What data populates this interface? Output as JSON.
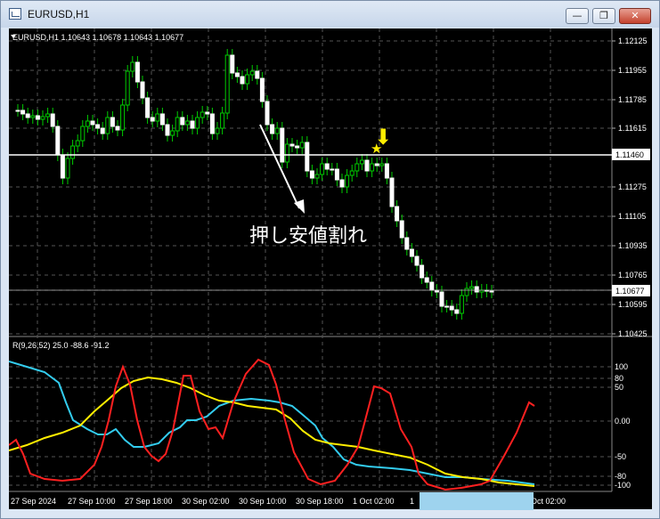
{
  "window": {
    "title": "EURUSD,H1",
    "minimize_glyph": "—",
    "restore_glyph": "❐",
    "close_glyph": "✕"
  },
  "main_chart": {
    "header": "EURUSD,H1  1.10643 1.10678 1.10643 1.10677",
    "price_axis": [
      "1.12125",
      "1.11955",
      "1.11785",
      "1.11615",
      "1.11460",
      "1.11275",
      "1.11105",
      "1.10935",
      "1.10765",
      "1.10677",
      "1.10595",
      "1.10425"
    ],
    "current_price_label": "1.10677",
    "support_line_label": "1.11460",
    "annotation": "押し安値割れ",
    "arrow_glyph": "⬇",
    "star_glyph": "★"
  },
  "indicator": {
    "header": "R(9,26,52) 25.0 -88.6 -91.2",
    "axis": [
      "100",
      "80",
      "50",
      "0.00",
      "-50",
      "-80",
      "-100"
    ]
  },
  "time_axis": [
    "27 Sep 2024",
    "27 Sep 10:00",
    "27 Sep 18:00",
    "30 Sep 02:00",
    "30 Sep 10:00",
    "30 Sep 18:00",
    "1 Oct 02:00",
    "1",
    "Oct 02:00"
  ],
  "colors": {
    "background": "#000000",
    "candle": "#ffffff",
    "bull_candle": "#00cc00",
    "red_line": "#ff2020",
    "cyan_line": "#33ccee",
    "yellow_line": "#ffee00",
    "annotation_marker": "#ffee00"
  }
}
